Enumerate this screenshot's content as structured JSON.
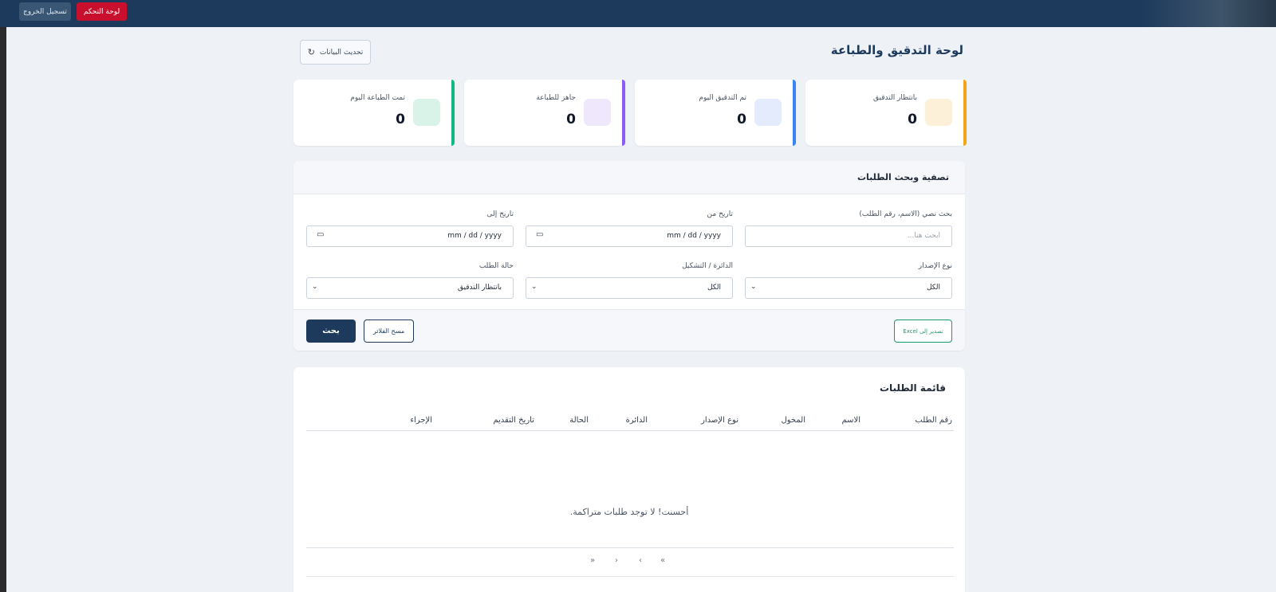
{
  "topbar": {
    "logout_label": "تسجيل الخروج",
    "dashboard_label": "لوحة التحكم"
  },
  "header": {
    "title": "لوحة التدقيق والطباعة",
    "refresh_label": "تحديث البيانات",
    "refresh_icon": "refresh-icon"
  },
  "stats": [
    {
      "label": "بانتظار التدقيق",
      "value": "0",
      "accent": "#f2a51a",
      "tint": "#fdf0d8"
    },
    {
      "label": "تم التدقيق اليوم",
      "value": "0",
      "accent": "#3b82f6",
      "tint": "#e3ebfc"
    },
    {
      "label": "جاهز للطباعة",
      "value": "0",
      "accent": "#8b5cf6",
      "tint": "#efe7fb"
    },
    {
      "label": "تمت الطباعة اليوم",
      "value": "0",
      "accent": "#10b981",
      "tint": "#daf3e9"
    }
  ],
  "filters": {
    "title": "تصفية وبحث الطلبات",
    "text_search": {
      "label": "بحث نصي (الاسم، رقم الطلب)",
      "placeholder": "ابحث هنا..."
    },
    "date_from": {
      "label": "تاريخ من",
      "value": "mm / dd / yyyy"
    },
    "date_to": {
      "label": "تاريخ إلى",
      "value": "mm / dd / yyyy"
    },
    "issue_type": {
      "label": "نوع الإصدار",
      "value": "الكل"
    },
    "department": {
      "label": "الدائرة / التشكيل",
      "value": "الكل"
    },
    "request_status": {
      "label": "حالة الطلب",
      "value": "بانتظار التدقيق"
    },
    "search_label": "بحث",
    "clear_label": "مسح الفلاتر",
    "export_label": "تصدير إلى Excel"
  },
  "requests": {
    "title": "قائمة الطلبات",
    "columns": [
      "رقم الطلب",
      "الاسم",
      "المخول",
      "نوع الإصدار",
      "الدائرة",
      "الحالة",
      "تاريخ التقديم",
      "الإجراء"
    ],
    "empty_message": "أحسنت! لا توجد طلبات متراكمة.",
    "pager": [
      "«",
      "‹",
      "›",
      "»"
    ]
  }
}
